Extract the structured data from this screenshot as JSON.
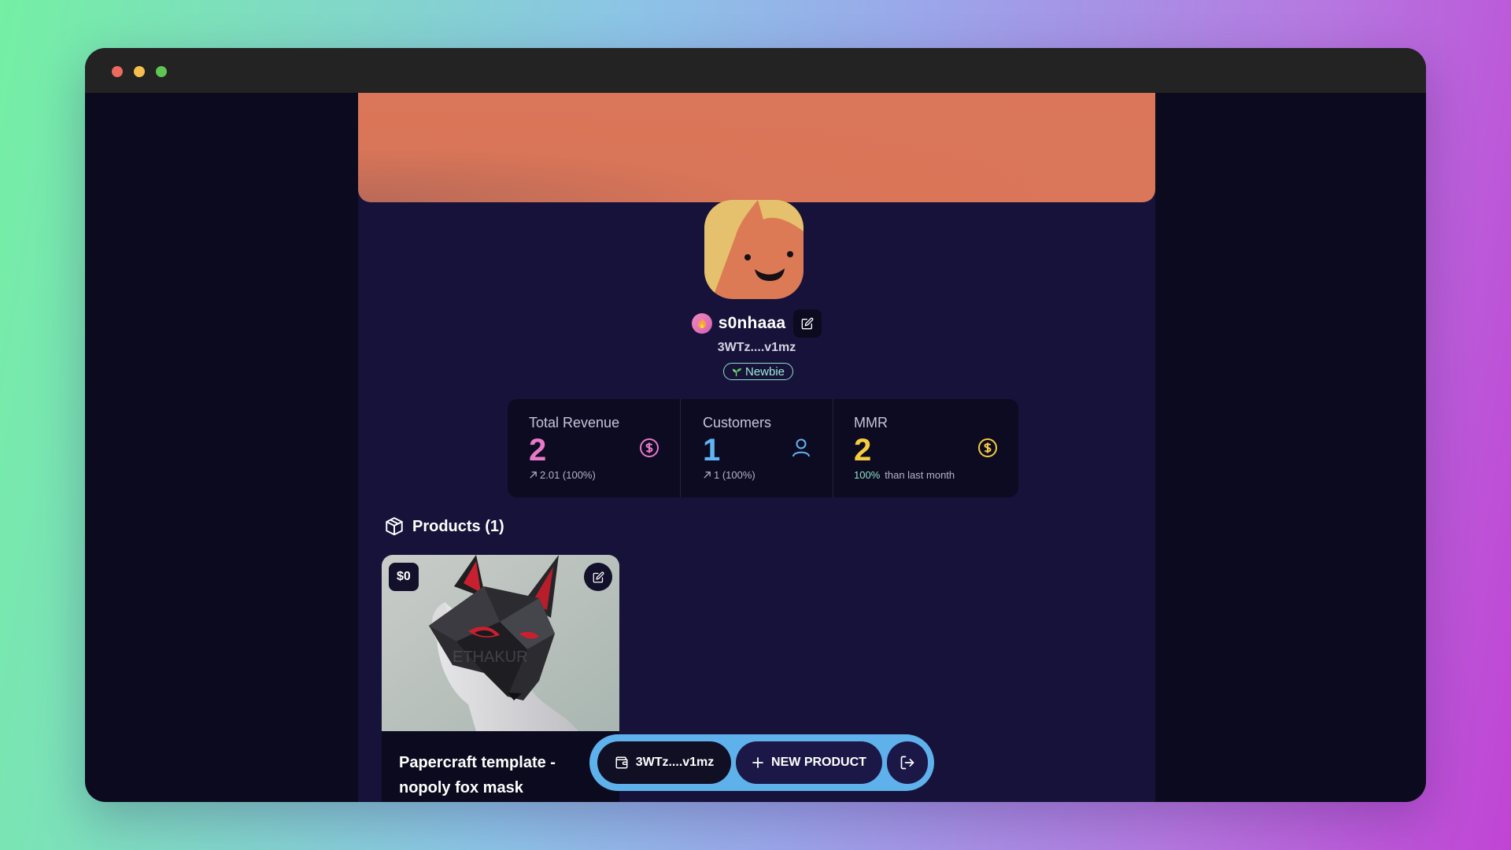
{
  "profile": {
    "username": "s0nhaaa",
    "wallet_short": "3WTz....v1mz",
    "level": "Newbie"
  },
  "stats": [
    {
      "label": "Total Revenue",
      "value": "2",
      "sub": "2.01 (100%)",
      "color": "#e879c9",
      "icon": "dollar-circle-icon"
    },
    {
      "label": "Customers",
      "value": "1",
      "sub": "1 (100%)",
      "color": "#5fb5f0",
      "icon": "user-icon"
    },
    {
      "label": "MMR",
      "value": "2",
      "sub_accent": "100%",
      "sub": "than last month",
      "color": "#f5cc3f",
      "icon": "dollar-circle-icon"
    }
  ],
  "products": {
    "heading": "Products (1)",
    "items": [
      {
        "price": "$0",
        "title": "Papercraft template - nopoly fox mask",
        "watermark": "ETHAKUR"
      }
    ]
  },
  "bottom_bar": {
    "wallet_label": "3WTz....v1mz",
    "new_product_label": "NEW PRODUCT"
  },
  "colors": {
    "banner": "#db765a",
    "page_bg": "#17123a",
    "bar_ring": "#5eb1ea"
  }
}
